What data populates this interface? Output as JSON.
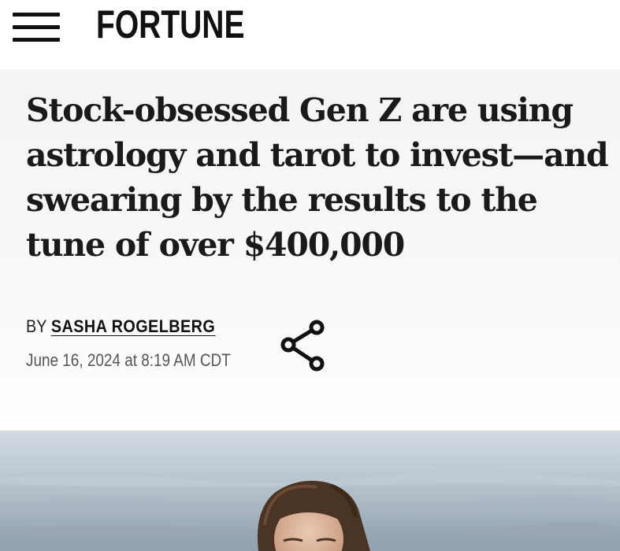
{
  "header": {
    "logo": "FORTUNE",
    "menu_icon": "hamburger-menu-icon"
  },
  "article": {
    "headline": "Stock-obsessed Gen Z are using astrology and tarot to invest—and swearing by the results to the tune of over $400,000",
    "byline_prefix": "BY",
    "author": "SASHA ROGELBERG",
    "timestamp": "June 16, 2024 at 8:19 AM CDT",
    "share_icon": "share-icon"
  },
  "hero_image": {
    "description_icon": "hero-photo"
  },
  "colors": {
    "text": "#1a1a1a",
    "muted": "#555555",
    "panel_background": "#f5f5f5"
  }
}
